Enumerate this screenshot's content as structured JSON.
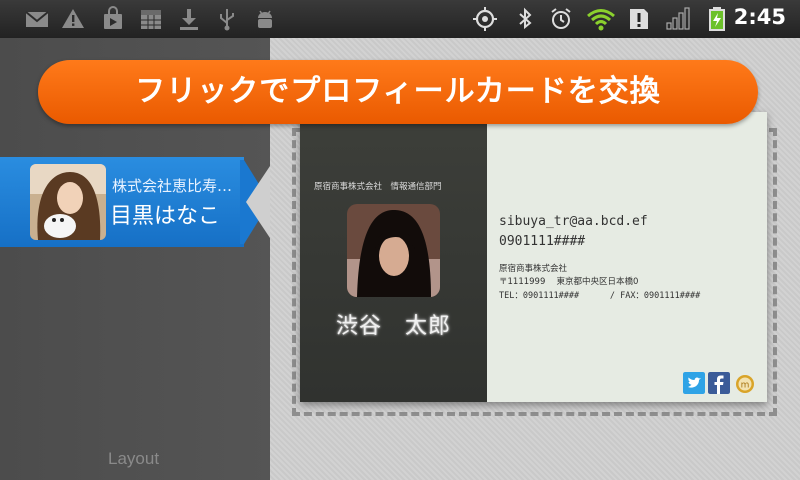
{
  "status_bar": {
    "time": "2:45",
    "left_icons": [
      "gmail-icon",
      "warning-icon",
      "market-icon",
      "calendar-icon",
      "download-icon",
      "usb-icon",
      "android-debug-icon"
    ],
    "right_icons": [
      "gps-icon",
      "bluetooth-icon",
      "alarm-icon",
      "wifi-icon",
      "notification-icon",
      "signal-icon",
      "battery-icon"
    ]
  },
  "banner": {
    "text": "フリックでプロフィールカードを交換"
  },
  "contact": {
    "company": "株式会社恵比寿…",
    "name": "目黒はなこ"
  },
  "left_panel": {
    "layout_label": "Layout"
  },
  "card": {
    "department": "原宿商事株式会社　情報通信部門",
    "name": "渋谷　太郎",
    "email": "sibuya_tr@aa.bcd.ef",
    "phone": "0901111####",
    "company": "原宿商事株式会社",
    "address": "〒1111999　 東京都中央区日本橋0",
    "telfax": "TEL：0901111####      / FAX：0901111####",
    "social": [
      "twitter-icon",
      "facebook-icon",
      "mixi-icon"
    ]
  },
  "colors": {
    "banner": "#f26a0a",
    "contact_highlight": "#1e7fd6",
    "card_dark": "#363834",
    "card_light": "#e6ebe3"
  }
}
